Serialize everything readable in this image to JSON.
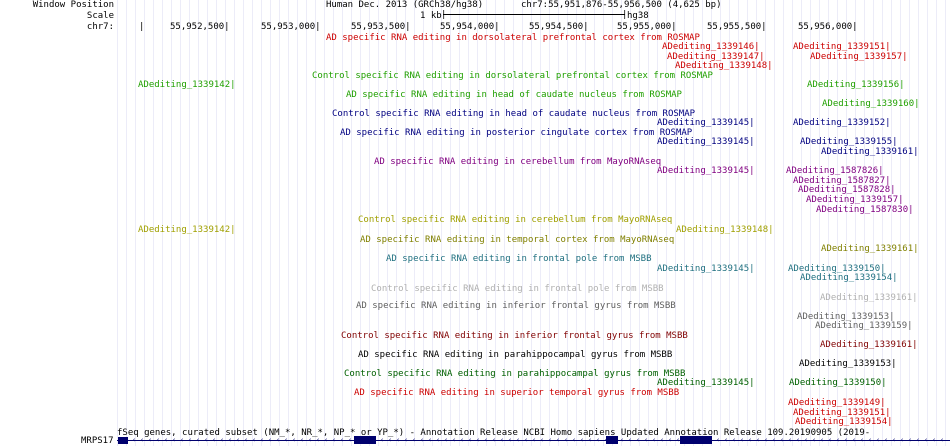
{
  "header": {
    "window_position_label": "Window Position",
    "scale_label": "Scale",
    "chrom_label": "chr7:",
    "assembly": "Human Dec. 2013 (GRCh38/hg38)",
    "position": "chr7:55,951,876-55,956,500 (4,625 bp)",
    "scale_value": "1 kb",
    "scale_assembly": "hg38"
  },
  "ruler": {
    "ticks": [
      "55,952,500|",
      "55,953,000|",
      "55,953,500|",
      "55,954,000|",
      "55,954,500|",
      "55,955,000|",
      "55,955,500|",
      "55,956,000|"
    ]
  },
  "colors": {
    "ad_red": "#cc0000",
    "control_green": "#20a000",
    "navy": "#000080",
    "purple": "#800080",
    "olive": "#a0a000",
    "teal": "#207080",
    "gray": "#b0b0b0",
    "dark_gray": "#606060",
    "gene_blue": "#00006e"
  },
  "tracks": [
    {
      "title": "AD specific RNA editing in dorsolateral prefrontal cortex from ROSMAP",
      "color": "#cc0000"
    },
    {
      "title": "Control specific RNA editing in dorsolateral prefrontal cortex from ROSMAP",
      "color": "#20a000"
    },
    {
      "title": "AD specific RNA editing in head of caudate nucleus from ROSMAP",
      "color": "#20a000"
    },
    {
      "title": "Control specific RNA editing in head of caudate nucleus from ROSMAP",
      "color": "#000080"
    },
    {
      "title": "AD specific RNA editing in posterior cingulate cortex from ROSMAP",
      "color": "#000080"
    },
    {
      "title": "AD specific RNA editing in cerebellum from MayoRNAseq",
      "color": "#800080"
    },
    {
      "title": "Control specific RNA editing in cerebellum from MayoRNAseq",
      "color": "#a0a000"
    },
    {
      "title": "AD specific RNA editing in temporal cortex from MayoRNAseq",
      "color": "#808000"
    },
    {
      "title": "AD specific RNA editing in frontal pole from MSBB",
      "color": "#207080"
    },
    {
      "title": "Control specific RNA editing in frontal pole from MSBB",
      "color": "#b0b0b0"
    },
    {
      "title": "AD specific RNA editing in inferior frontal gyrus from MSBB",
      "color": "#606060"
    },
    {
      "title": "Control specific RNA editing in inferior frontal gyrus from MSBB",
      "color": "#800000"
    },
    {
      "title": "AD specific RNA editing in parahippocampal gyrus from MSBB",
      "color": "#000000"
    },
    {
      "title": "Control specific RNA editing in parahippocampal gyrus from MSBB",
      "color": "#006000"
    },
    {
      "title": "AD specific RNA editing in superior temporal gyrus from MSBB",
      "color": "#cc0000"
    }
  ],
  "items": [
    {
      "text": "ADediting_1339146|",
      "color": "#cc0000"
    },
    {
      "text": "ADediting_1339151|",
      "color": "#cc0000"
    },
    {
      "text": "ADediting_1339147|",
      "color": "#cc0000"
    },
    {
      "text": "ADediting_1339157|",
      "color": "#cc0000"
    },
    {
      "text": "ADediting_1339148|",
      "color": "#cc0000"
    },
    {
      "text": "ADediting_1339142|",
      "color": "#20a000"
    },
    {
      "text": "ADediting_1339156|",
      "color": "#20a000"
    },
    {
      "text": "ADediting_1339160|",
      "color": "#20a000"
    },
    {
      "text": "ADediting_1339145|",
      "color": "#000080"
    },
    {
      "text": "ADediting_1339152|",
      "color": "#000080"
    },
    {
      "text": "ADediting_1339145|",
      "color": "#000080"
    },
    {
      "text": "ADediting_1339155|",
      "color": "#000080"
    },
    {
      "text": "ADediting_1339161|",
      "color": "#000080"
    },
    {
      "text": "ADediting_1339145|",
      "color": "#800080"
    },
    {
      "text": "ADediting_1587826|",
      "color": "#800080"
    },
    {
      "text": "ADediting_1587827|",
      "color": "#800080"
    },
    {
      "text": "ADediting_1587828|",
      "color": "#800080"
    },
    {
      "text": "ADediting_1339157|",
      "color": "#800080"
    },
    {
      "text": "ADediting_1587830|",
      "color": "#800080"
    },
    {
      "text": "ADediting_1339142|",
      "color": "#a0a000"
    },
    {
      "text": "ADediting_1339148|",
      "color": "#a0a000"
    },
    {
      "text": "ADediting_1339161|",
      "color": "#808000"
    },
    {
      "text": "ADediting_1339145|",
      "color": "#207080"
    },
    {
      "text": "ADediting_1339150|",
      "color": "#207080"
    },
    {
      "text": "ADediting_1339154|",
      "color": "#207080"
    },
    {
      "text": "ADediting_1339161|",
      "color": "#b0b0b0"
    },
    {
      "text": "ADediting_1339153|",
      "color": "#606060"
    },
    {
      "text": "ADediting_1339159|",
      "color": "#606060"
    },
    {
      "text": "ADediting_1339161|",
      "color": "#800000"
    },
    {
      "text": "ADediting_1339153|",
      "color": "#000000"
    },
    {
      "text": "ADediting_1339145|",
      "color": "#006000"
    },
    {
      "text": "ADediting_1339150|",
      "color": "#006000"
    },
    {
      "text": "ADediting_1339149|",
      "color": "#cc0000"
    },
    {
      "text": "ADediting_1339151|",
      "color": "#cc0000"
    },
    {
      "text": "ADediting_1339154|",
      "color": "#cc0000"
    }
  ],
  "gene_track": {
    "title": "fSeq genes, curated subset (NM_*, NR_*, NP_* or YP_*) - Annotation Release NCBI Homo sapiens Updated Annotation Release 109.20190905 (2019-",
    "gene_label": "MRPS17"
  }
}
